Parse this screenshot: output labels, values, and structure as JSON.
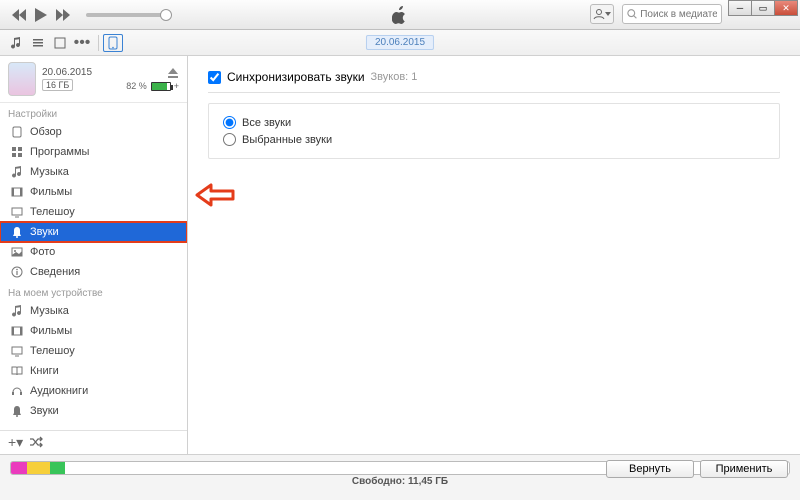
{
  "toolbar": {
    "search_placeholder": "Поиск в медиатеке",
    "date_pill": "20.06.2015"
  },
  "device": {
    "date": "20.06.2015",
    "capacity": "16 ГБ",
    "battery_pct": "82 %",
    "charging": "+"
  },
  "sidebar": {
    "group_settings": "Настройки",
    "settings": [
      {
        "label": "Обзор",
        "icon": "summary-icon"
      },
      {
        "label": "Программы",
        "icon": "apps-icon"
      },
      {
        "label": "Музыка",
        "icon": "music-icon"
      },
      {
        "label": "Фильмы",
        "icon": "movies-icon"
      },
      {
        "label": "Телешоу",
        "icon": "tv-icon"
      },
      {
        "label": "Звуки",
        "icon": "tones-icon"
      },
      {
        "label": "Фото",
        "icon": "photos-icon"
      },
      {
        "label": "Сведения",
        "icon": "info-icon"
      }
    ],
    "group_device": "На моем устройстве",
    "ondevice": [
      {
        "label": "Музыка",
        "icon": "music-icon"
      },
      {
        "label": "Фильмы",
        "icon": "movies-icon"
      },
      {
        "label": "Телешоу",
        "icon": "tv-icon"
      },
      {
        "label": "Книги",
        "icon": "books-icon"
      },
      {
        "label": "Аудиокниги",
        "icon": "audiobooks-icon"
      },
      {
        "label": "Звуки",
        "icon": "tones-icon"
      }
    ]
  },
  "main": {
    "sync_label": "Синхронизировать звуки",
    "sync_count": "Звуков: 1",
    "opt_all": "Все звуки",
    "opt_selected": "Выбранные звуки"
  },
  "footer": {
    "free_label": "Свободно: 11,45 ГБ",
    "revert": "Вернуть",
    "apply": "Применить",
    "segments": [
      {
        "class": "pink",
        "width": "2%"
      },
      {
        "class": "yellow",
        "width": "3%"
      },
      {
        "class": "green",
        "width": "2%"
      }
    ]
  },
  "colors": {
    "selection": "#1f68d8",
    "annotation": "#e43c1a"
  }
}
